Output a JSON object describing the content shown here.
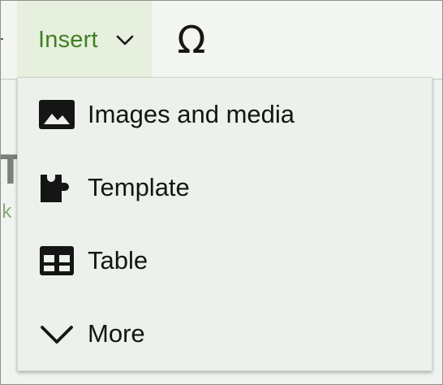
{
  "toolbar": {
    "insert_label": "Insert",
    "insert_chevron_icon": "chevron-down-icon",
    "special_character_glyph": "Ω",
    "special_character_icon": "omega-icon"
  },
  "background": {
    "title_fragment": "T",
    "subtitle_fragment": "ik"
  },
  "menu": {
    "items": [
      {
        "label": "Images and media",
        "icon": "image-icon"
      },
      {
        "label": "Template",
        "icon": "puzzle-icon"
      },
      {
        "label": "Table",
        "icon": "table-icon"
      },
      {
        "label": "More",
        "icon": "chevron-down-icon"
      }
    ]
  },
  "colors": {
    "accent": "#3f7f22",
    "insert_highlight": "#e7f0de",
    "menu_background": "#edf1eb",
    "text": "#121712"
  }
}
